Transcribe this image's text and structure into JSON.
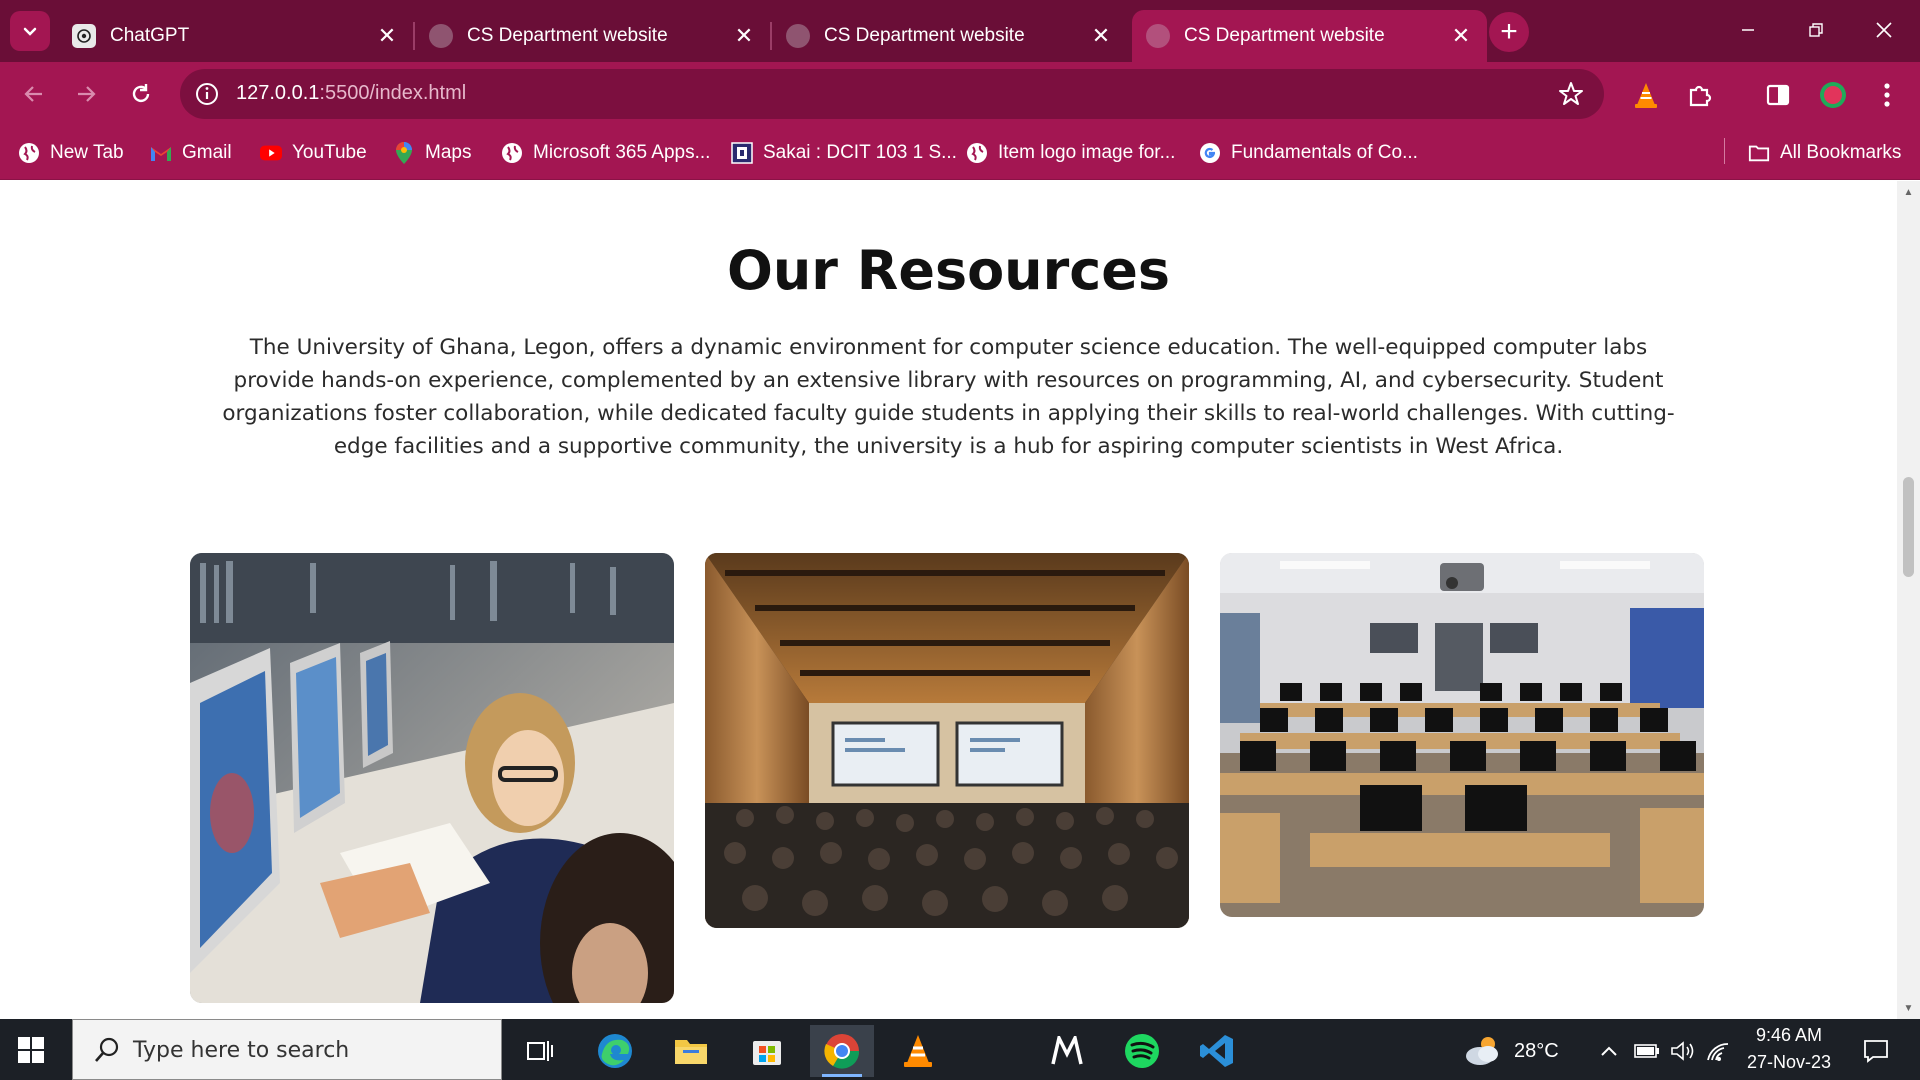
{
  "browser": {
    "tabs": [
      {
        "title": "ChatGPT",
        "favicon": "chatgpt-icon",
        "active": false
      },
      {
        "title": "CS Department website",
        "favicon": "globe-icon",
        "active": false
      },
      {
        "title": "CS Department website",
        "favicon": "globe-icon",
        "active": false
      },
      {
        "title": "CS Department website",
        "favicon": "globe-icon",
        "active": true
      }
    ],
    "url_host": "127.0.0.1",
    "url_path": ":5500/index.html",
    "bookmarks": [
      {
        "label": "New Tab",
        "icon": "globe-icon"
      },
      {
        "label": "Gmail",
        "icon": "gmail-icon"
      },
      {
        "label": "YouTube",
        "icon": "youtube-icon"
      },
      {
        "label": "Maps",
        "icon": "maps-icon"
      },
      {
        "label": "Microsoft 365 Apps...",
        "icon": "globe-icon"
      },
      {
        "label": "Sakai : DCIT 103 1 S...",
        "icon": "sakai-icon"
      },
      {
        "label": "Item logo image for...",
        "icon": "globe-icon"
      },
      {
        "label": "Fundamentals of Co...",
        "icon": "google-icon"
      }
    ],
    "all_bookmarks": "All Bookmarks",
    "colors": {
      "tabstrip": "#6a0e37",
      "toolbar": "#a31652",
      "omnibox": "#7c0f3f"
    }
  },
  "page": {
    "title": "Our Resources",
    "description": "The University of Ghana, Legon, offers a dynamic environment for computer science education. The well-equipped computer labs provide hands-on experience, complemented by an extensive library with resources on programming, AI, and cybersecurity. Student organizations foster collaboration, while dedicated faculty guide students in applying their skills to real-world challenges. With cutting-edge facilities and a supportive community, the university is a hub for aspiring computer scientists in West Africa.",
    "images": [
      {
        "subject": "students-at-computers-photo"
      },
      {
        "subject": "lecture-hall-photo"
      },
      {
        "subject": "computer-lab-photo"
      }
    ]
  },
  "taskbar": {
    "search_placeholder": "Type here to search",
    "weather": "28°C",
    "time": "9:46 AM",
    "date": "27-Nov-23"
  }
}
